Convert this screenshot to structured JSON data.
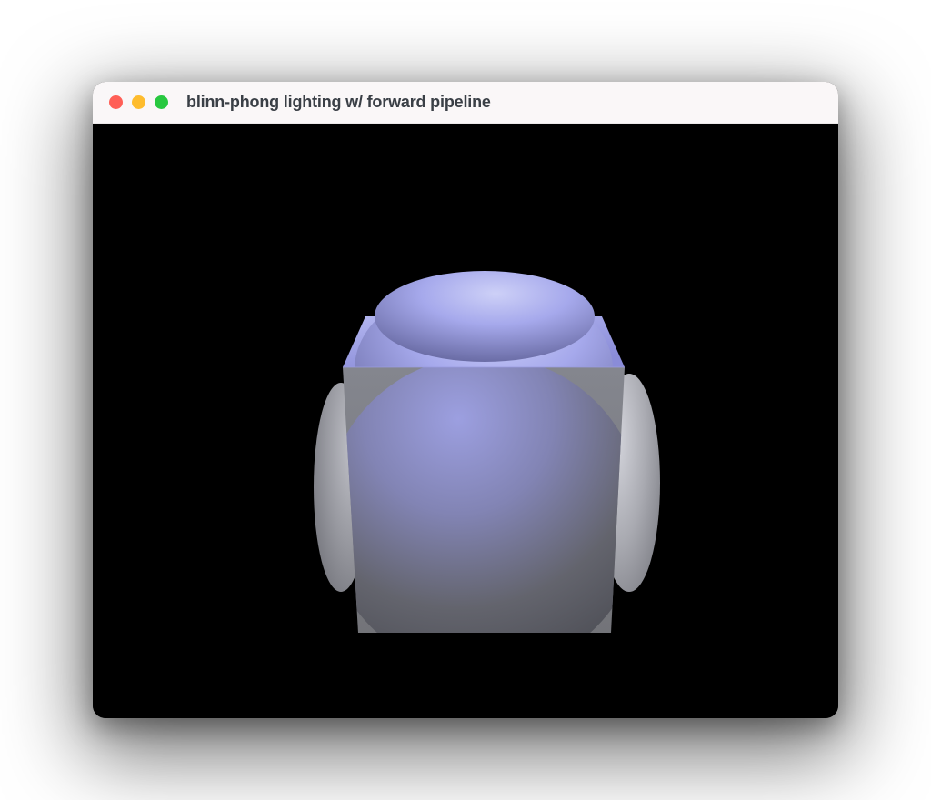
{
  "window": {
    "title": "blinn-phong lighting w/ forward pipeline"
  },
  "traffic_lights": {
    "close_color": "#ff5f57",
    "minimize_color": "#febc2e",
    "zoom_color": "#28c840"
  },
  "render": {
    "background": "#000000",
    "cube_top_fill": "#9ea0e8",
    "cube_front_fill": "#7b7d84",
    "cube_side_fill": "#6a6c73",
    "sphere_top_highlight": "#c1c5f4",
    "sphere_top_shadow": "#6d6fa8",
    "sphere_front_highlight": "#8f92d8",
    "sphere_front_shadow": "#4d4e55",
    "sphere_side_color": "#b7b8bf"
  }
}
